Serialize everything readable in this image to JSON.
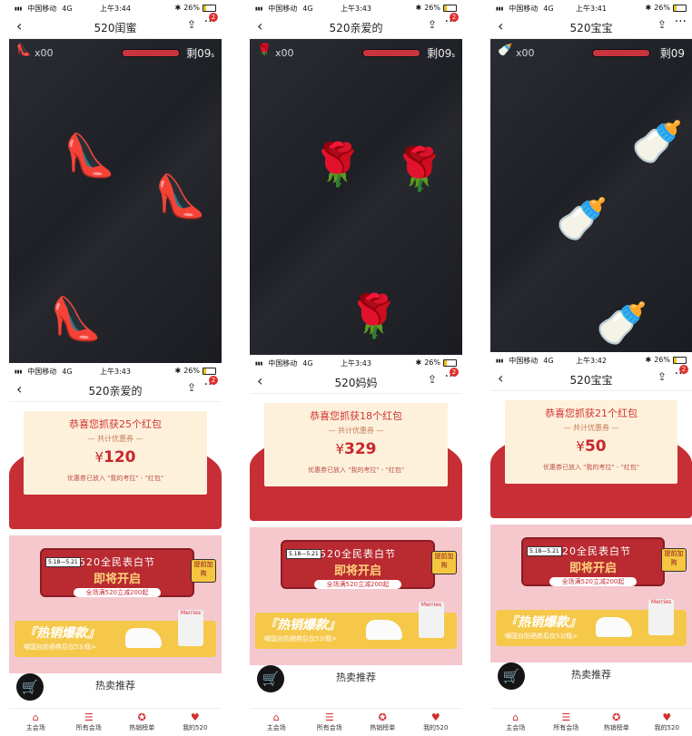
{
  "status": {
    "carrier": "中国移动",
    "network": "4G",
    "battery": "26%"
  },
  "panels": {
    "g1": {
      "time": "上午3:44",
      "title": "520闺蜜",
      "count": "x00",
      "timer": "剩09",
      "timer_unit": "s",
      "icon": "high-heel-icon",
      "sprite": "👠",
      "badge": "2"
    },
    "g2": {
      "time": "上午3:43",
      "title": "520亲爱的",
      "count": "x00",
      "timer": "剩09",
      "timer_unit": "s",
      "icon": "rose-icon",
      "sprite": "🌹",
      "badge": "2"
    },
    "g3": {
      "time": "上午3:41",
      "title": "520宝宝",
      "count": "x00",
      "timer": "剩09",
      "timer_unit": "",
      "icon": "pacifier-icon",
      "sprite": "🍼",
      "badge": ""
    },
    "r1": {
      "time": "上午3:43",
      "title": "520亲爱的",
      "congrats": "恭喜您抓获25个红包",
      "sub": "— 共计优惠券 —",
      "amount": "120",
      "note": "优惠券已放入 \"我的考拉\" - \"红包\"",
      "badge": "2"
    },
    "r2": {
      "time": "上午3:43",
      "title": "520妈妈",
      "congrats": "恭喜您抓获18个红包",
      "sub": "— 共计优惠券 —",
      "amount": "329",
      "note": "优惠券已放入 \"我的考拉\" - \"红包\"",
      "badge": "2"
    },
    "r3": {
      "time": "上午3:42",
      "title": "520宝宝",
      "congrats": "恭喜您抓获21个红包",
      "sub": "— 共计优惠券 —",
      "amount": "50",
      "note": "优惠券已放入 \"我的考拉\" - \"红包\"",
      "badge": "2"
    }
  },
  "promo": {
    "headline": "520全民表白节",
    "big": "即将开启",
    "pill": "全场满520立减200起",
    "date": "5.18—5.21",
    "side": "提前加购"
  },
  "hot": {
    "title": "『热销爆款』",
    "sub": "哪国台防晒券后仅53/瓶>",
    "pack_brand": "Merries",
    "section": "热卖推荐"
  },
  "currency": "¥",
  "tabs": [
    "主会场",
    "所有会场",
    "热销榜单",
    "我的520"
  ],
  "icons": {
    "back": "‹",
    "share": "⇪",
    "more": "···",
    "cart": "🛒",
    "tab_icons": [
      "⌂",
      "☰",
      "✪",
      "♥"
    ]
  },
  "colors": {
    "accent_red": "#c72e35",
    "card_bg": "#fdf1dc",
    "game_bg": "#1e2026"
  }
}
